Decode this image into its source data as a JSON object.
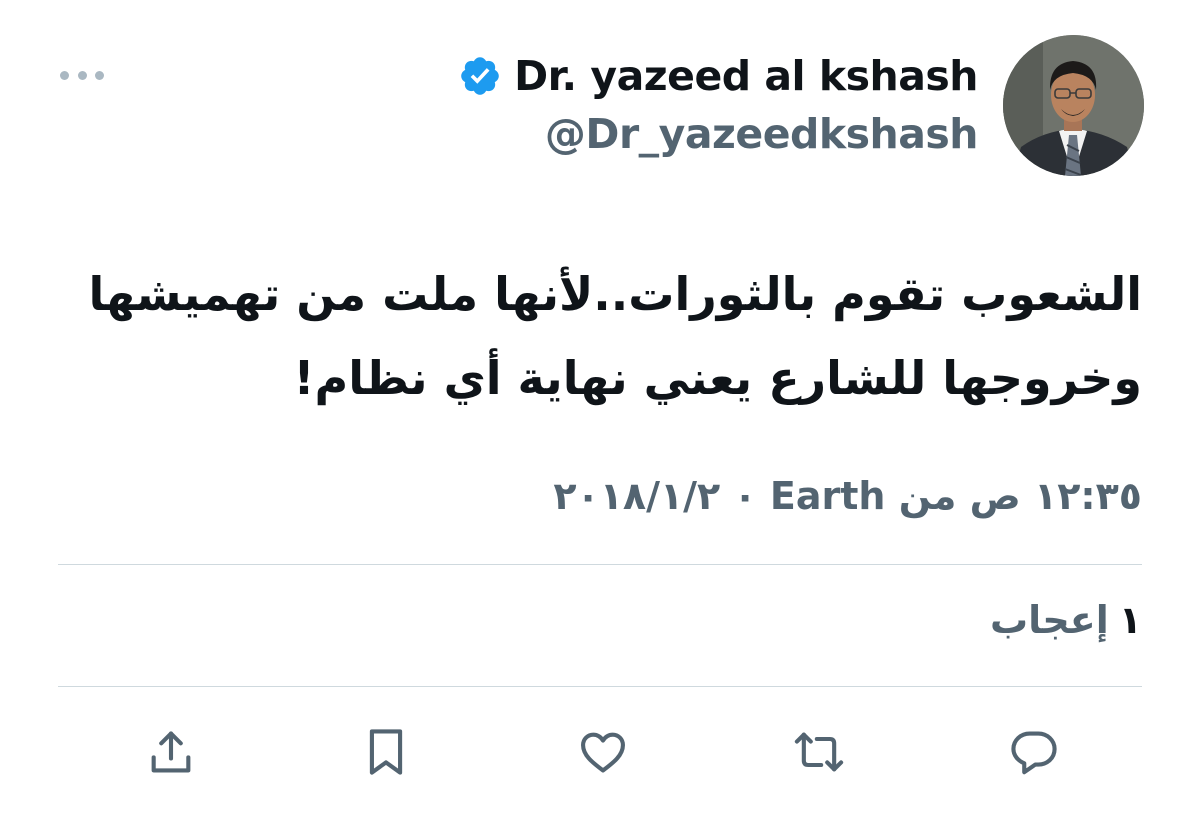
{
  "tweet": {
    "author": {
      "display_name": "Dr. yazeed al kshash",
      "handle": "@Dr_yazeedkshash",
      "verified": true,
      "avatar_icon": "person-photo"
    },
    "text_lines": [
      "الشعوب تقوم بالثورات..لأنها ملت من تهميشها",
      "وخروجها للشارع يعني نهاية أي نظام!"
    ],
    "meta": "١٢:٣٥ ص من Earth ٠ ٢٠١٨/١/٢",
    "likes": {
      "count": "١",
      "label": "إعجاب"
    }
  },
  "actions": [
    {
      "name": "share",
      "icon": "share-icon"
    },
    {
      "name": "bookmark",
      "icon": "bookmark-icon"
    },
    {
      "name": "like",
      "icon": "heart-icon"
    },
    {
      "name": "retweet",
      "icon": "retweet-icon"
    },
    {
      "name": "reply",
      "icon": "reply-icon"
    }
  ],
  "colors": {
    "text_primary": "#0f1419",
    "text_secondary": "#536471",
    "verified_blue": "#1d9bf0",
    "divider": "#cfd9de"
  }
}
